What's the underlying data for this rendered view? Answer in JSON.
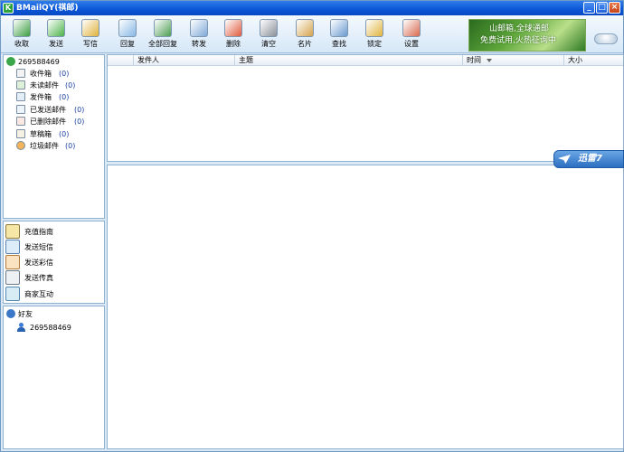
{
  "window": {
    "title": "BMailQY(祺邮)",
    "icon_letter": "K",
    "minimize": "_",
    "maximize": "□",
    "close": "×"
  },
  "toolbar": {
    "buttons": [
      {
        "label": "收取",
        "icon": "receive-icon",
        "color": "#3a9e3f"
      },
      {
        "label": "发送",
        "icon": "send-icon",
        "color": "#4bb248"
      },
      {
        "label": "写信",
        "icon": "compose-icon",
        "color": "#e0b23b"
      },
      {
        "label": "回复",
        "icon": "reply-icon",
        "color": "#86b7e4"
      },
      {
        "label": "全部回复",
        "icon": "reply-all-icon",
        "color": "#4c9d53"
      },
      {
        "label": "转发",
        "icon": "forward-icon",
        "color": "#7fa9d8"
      },
      {
        "label": "删除",
        "icon": "delete-icon",
        "color": "#e05a3c"
      },
      {
        "label": "清空",
        "icon": "trash-icon",
        "color": "#8a8f98"
      },
      {
        "label": "名片",
        "icon": "contact-card-icon",
        "color": "#d4a24a"
      },
      {
        "label": "查找",
        "icon": "find-icon",
        "color": "#6b9ad0"
      },
      {
        "label": "锁定",
        "icon": "lock-icon",
        "color": "#e1b33c"
      },
      {
        "label": "设置",
        "icon": "settings-icon",
        "color": "#d9684e"
      }
    ],
    "ad": {
      "line1": "山邮箱,全球通邮",
      "line2": "免费试用,火热征询中"
    }
  },
  "folders": {
    "account": "269588469",
    "items": [
      {
        "label": "收件箱",
        "count": "(0)",
        "icon": "inbox-icon"
      },
      {
        "label": "未读邮件",
        "count": "(0)",
        "icon": "unread-icon"
      },
      {
        "label": "发件箱",
        "count": "(0)",
        "icon": "outbox-icon"
      },
      {
        "label": "已发送邮件",
        "count": "(0)",
        "icon": "sent-icon"
      },
      {
        "label": "已删除邮件",
        "count": "(0)",
        "icon": "deleted-icon"
      },
      {
        "label": "草稿箱",
        "count": "(0)",
        "icon": "drafts-icon"
      },
      {
        "label": "垃圾邮件",
        "count": "(0)",
        "icon": "spam-icon"
      }
    ]
  },
  "services": [
    {
      "label": "充值指南",
      "icon": "recharge-icon"
    },
    {
      "label": "发送短信",
      "icon": "sms-icon"
    },
    {
      "label": "发送彩信",
      "icon": "mms-icon"
    },
    {
      "label": "发送传真",
      "icon": "fax-icon"
    },
    {
      "label": "商家互动",
      "icon": "merchant-icon"
    }
  ],
  "friends": {
    "group_label": "好友",
    "members": [
      {
        "name": "269588469"
      }
    ]
  },
  "mail_list": {
    "columns": [
      "发件人",
      "主题",
      "时间",
      "大小"
    ]
  },
  "badge": {
    "text": "迅雷7"
  }
}
